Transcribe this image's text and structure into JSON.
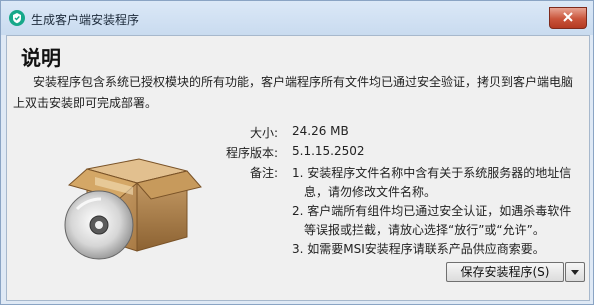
{
  "window": {
    "title": "生成客户端安装程序",
    "close_icon": "close-icon",
    "app_icon": "shield-app-icon"
  },
  "content": {
    "heading": "说明",
    "intro_line1": "安装程序包含系统已授权模块的所有功能，客户端程序所有文件均已通过安全验证，拷贝到客户端电脑",
    "intro_line2": "上双击安装即可完成部署。",
    "illustration": "package-box-icon"
  },
  "info": {
    "size_label": "大小:",
    "size_value": "24.26 MB",
    "version_label": "程序版本:",
    "version_value": "5.1.15.2502",
    "notes_label": "备注:",
    "notes": [
      "1. 安装程序文件名称中含有关于系统服务器的地址信息，请勿修改文件名称。",
      "2. 客户端所有组件均已通过安全认证，如遇杀毒软件等误报或拦截，请放心选择“放行”或“允许”。",
      "3. 如需要MSI安装程序请联系产品供应商索要。"
    ]
  },
  "actions": {
    "save_label": "保存安装程序(S)",
    "dropdown_icon": "caret-down-icon"
  },
  "colors": {
    "accent": "#17a889",
    "close": "#c9533a",
    "titlebar": "#d5e4f5",
    "client_bg": "#f0f0f0"
  }
}
